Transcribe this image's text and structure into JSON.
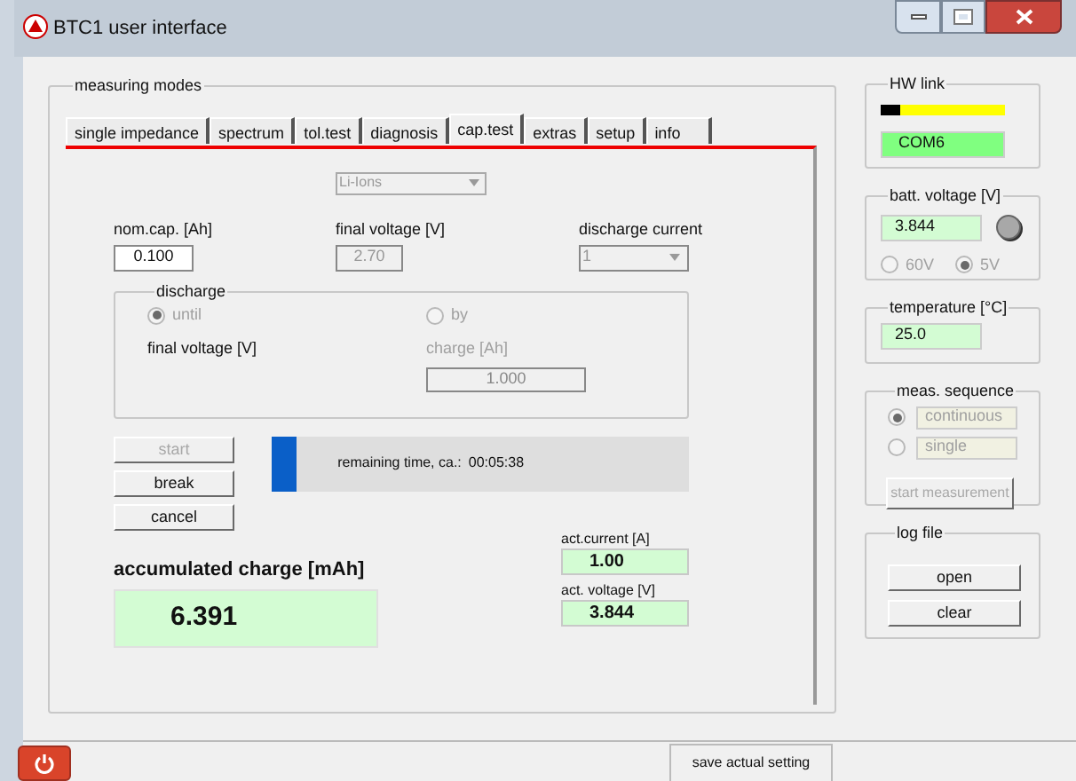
{
  "window": {
    "title": "BTC1 user interface"
  },
  "measuring_modes": {
    "title": "measuring modes",
    "tabs": [
      {
        "label": "single impedance",
        "selected": false
      },
      {
        "label": "spectrum",
        "selected": false
      },
      {
        "label": "tol.test",
        "selected": false
      },
      {
        "label": "diagnosis",
        "selected": false
      },
      {
        "label": "cap.test",
        "selected": true
      },
      {
        "label": "extras",
        "selected": false
      },
      {
        "label": "setup",
        "selected": false
      },
      {
        "label": "info",
        "selected": false
      }
    ],
    "battery_type": {
      "value": "Li-Ions",
      "disabled": true
    },
    "fields": [
      {
        "label": "nom.cap. [Ah]",
        "value": "0.100",
        "kind": "input",
        "disabled": false
      },
      {
        "label": "final voltage [V]",
        "value": "2.70",
        "kind": "input",
        "disabled": true
      },
      {
        "label": "discharge current",
        "value": "1",
        "kind": "dropdown",
        "disabled": true
      }
    ],
    "discharge": {
      "title": "discharge",
      "options": [
        {
          "label": "until",
          "selected": true,
          "disabled": true,
          "caption": "final voltage [V]",
          "caption_disabled": false
        },
        {
          "label": "by",
          "selected": false,
          "disabled": true,
          "caption": "charge [Ah]",
          "caption_disabled": true,
          "value": "1.000"
        }
      ]
    },
    "buttons": [
      {
        "label": "start",
        "disabled": true
      },
      {
        "label": "break",
        "disabled": false
      },
      {
        "label": "cancel",
        "disabled": false
      }
    ],
    "progress": {
      "level": 0.06,
      "label": "remaining time, ca.:",
      "time": "00:05:38"
    },
    "accumulated_charge": {
      "label": "accumulated charge [mAh]",
      "value": "6.391"
    },
    "readings": [
      {
        "label": "act.current [A]",
        "value": "1.00"
      },
      {
        "label": "act. voltage [V]",
        "value": "3.844"
      }
    ]
  },
  "hw_link": {
    "title": "HW link",
    "level": 0.15,
    "port": "COM6"
  },
  "batt_voltage": {
    "title": "batt. voltage [V]",
    "value": "3.844",
    "ranges": [
      {
        "label": "60V",
        "selected": false,
        "disabled": true
      },
      {
        "label": "5V",
        "selected": true,
        "disabled": true
      }
    ]
  },
  "temperature": {
    "title": "temperature [°C]",
    "value": "25.0"
  },
  "meas_sequence": {
    "title": "meas. sequence",
    "options": [
      {
        "label": "continuous",
        "selected": true,
        "disabled": true
      },
      {
        "label": "single",
        "selected": false,
        "disabled": true
      }
    ],
    "button": {
      "label": "start measurement",
      "disabled": true
    }
  },
  "log_file": {
    "title": "log file",
    "buttons": [
      {
        "label": "open",
        "disabled": false
      },
      {
        "label": "clear",
        "disabled": false
      }
    ]
  },
  "footer": {
    "button": "save actual setting"
  }
}
